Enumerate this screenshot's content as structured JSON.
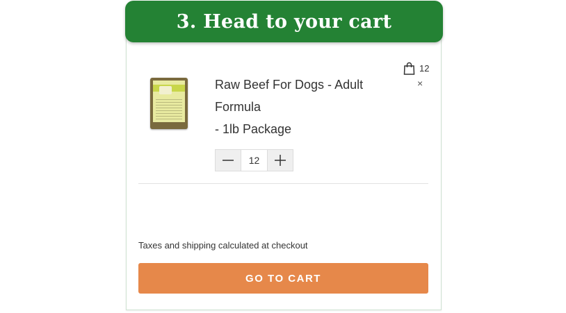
{
  "banner": {
    "title": "3. Head to your cart"
  },
  "cart": {
    "icon": "shopping-bag-icon",
    "count": "12"
  },
  "item": {
    "name_line1": "Raw Beef For Dogs - Adult Formula",
    "name_line2": "- 1lb Package",
    "remove_icon": "close-icon",
    "quantity": "12"
  },
  "footer": {
    "tax_note": "Taxes and shipping calculated at checkout",
    "button_label": "GO TO CART"
  },
  "colors": {
    "banner_green": "#248234",
    "button_orange": "#e6884a"
  }
}
